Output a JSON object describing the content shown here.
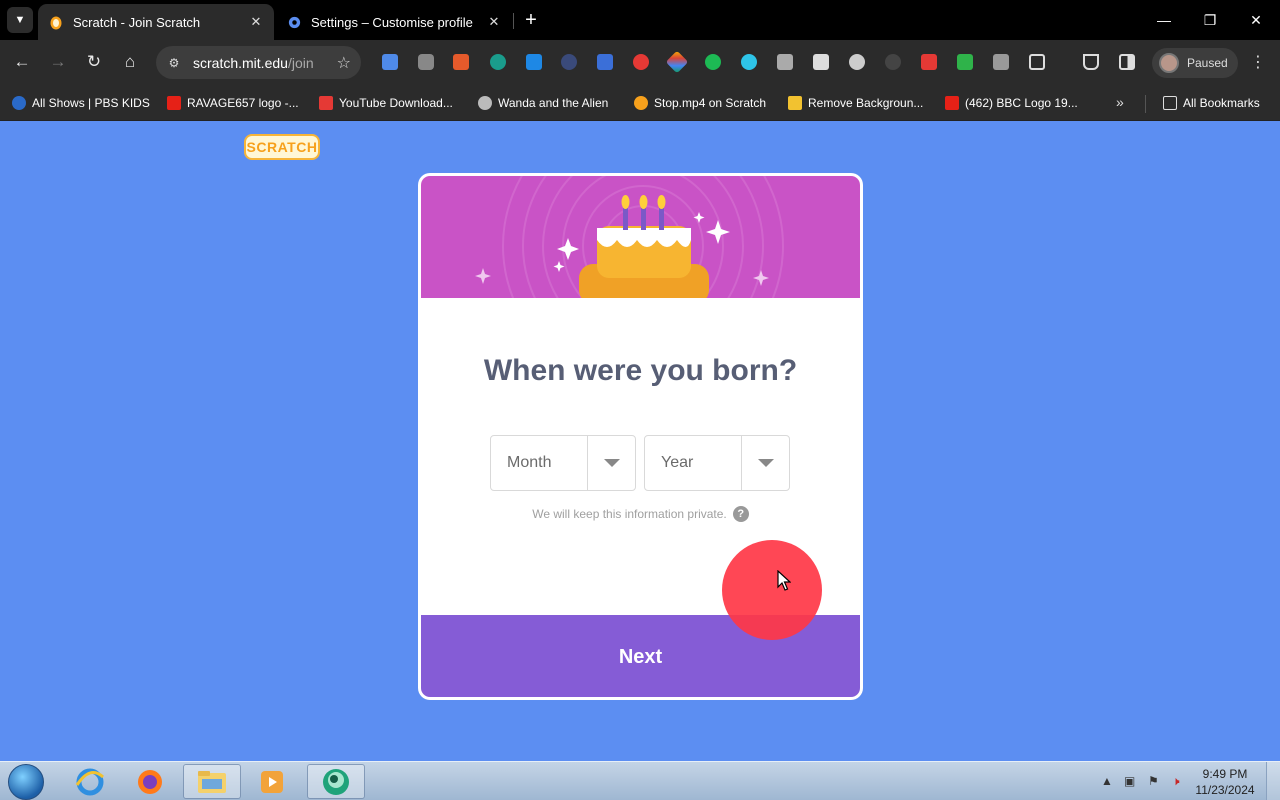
{
  "browser": {
    "tabs": [
      {
        "title": "Scratch - Join Scratch",
        "active": true,
        "icon": "scratch-cat-icon"
      },
      {
        "title": "Settings – Customise profile",
        "active": false,
        "icon": "gear-icon"
      }
    ],
    "address": {
      "host": "scratch.mit.edu",
      "path": "/join"
    },
    "profile_label": "Paused",
    "bookmarks": [
      {
        "label": "All Shows | PBS KIDS",
        "icon": "pbs-kids-icon"
      },
      {
        "label": "RAVAGE657 logo -...",
        "icon": "youtube-icon"
      },
      {
        "label": "YouTube Download...",
        "icon": "download-icon"
      },
      {
        "label": "Wanda and the Alien",
        "icon": "globe-icon"
      },
      {
        "label": "Stop.mp4 on Scratch",
        "icon": "scratch-cat-icon"
      },
      {
        "label": "Remove Backgroun...",
        "icon": "remove-bg-icon"
      },
      {
        "label": "(462) BBC Logo 19...",
        "icon": "youtube-icon"
      }
    ],
    "all_bookmarks_label": "All Bookmarks"
  },
  "page": {
    "logo_text": "SCRATCH",
    "heading": "When were you born?",
    "month_select": {
      "value": "Month"
    },
    "year_select": {
      "value": "Year"
    },
    "privacy_note": "We will keep this information private.",
    "help_symbol": "?",
    "next_label": "Next"
  },
  "taskbar": {
    "time": "9:49 PM",
    "date": "11/23/2024",
    "apps": [
      "internet-explorer-icon",
      "firefox-icon",
      "file-explorer-icon",
      "media-player-icon",
      "app-icon"
    ]
  },
  "colors": {
    "page_bg": "#5c8ef2",
    "header_bg": "#c953c6",
    "button_bg": "#855cd6",
    "heading_text": "#575e75",
    "click_marker": "#ff3746"
  }
}
